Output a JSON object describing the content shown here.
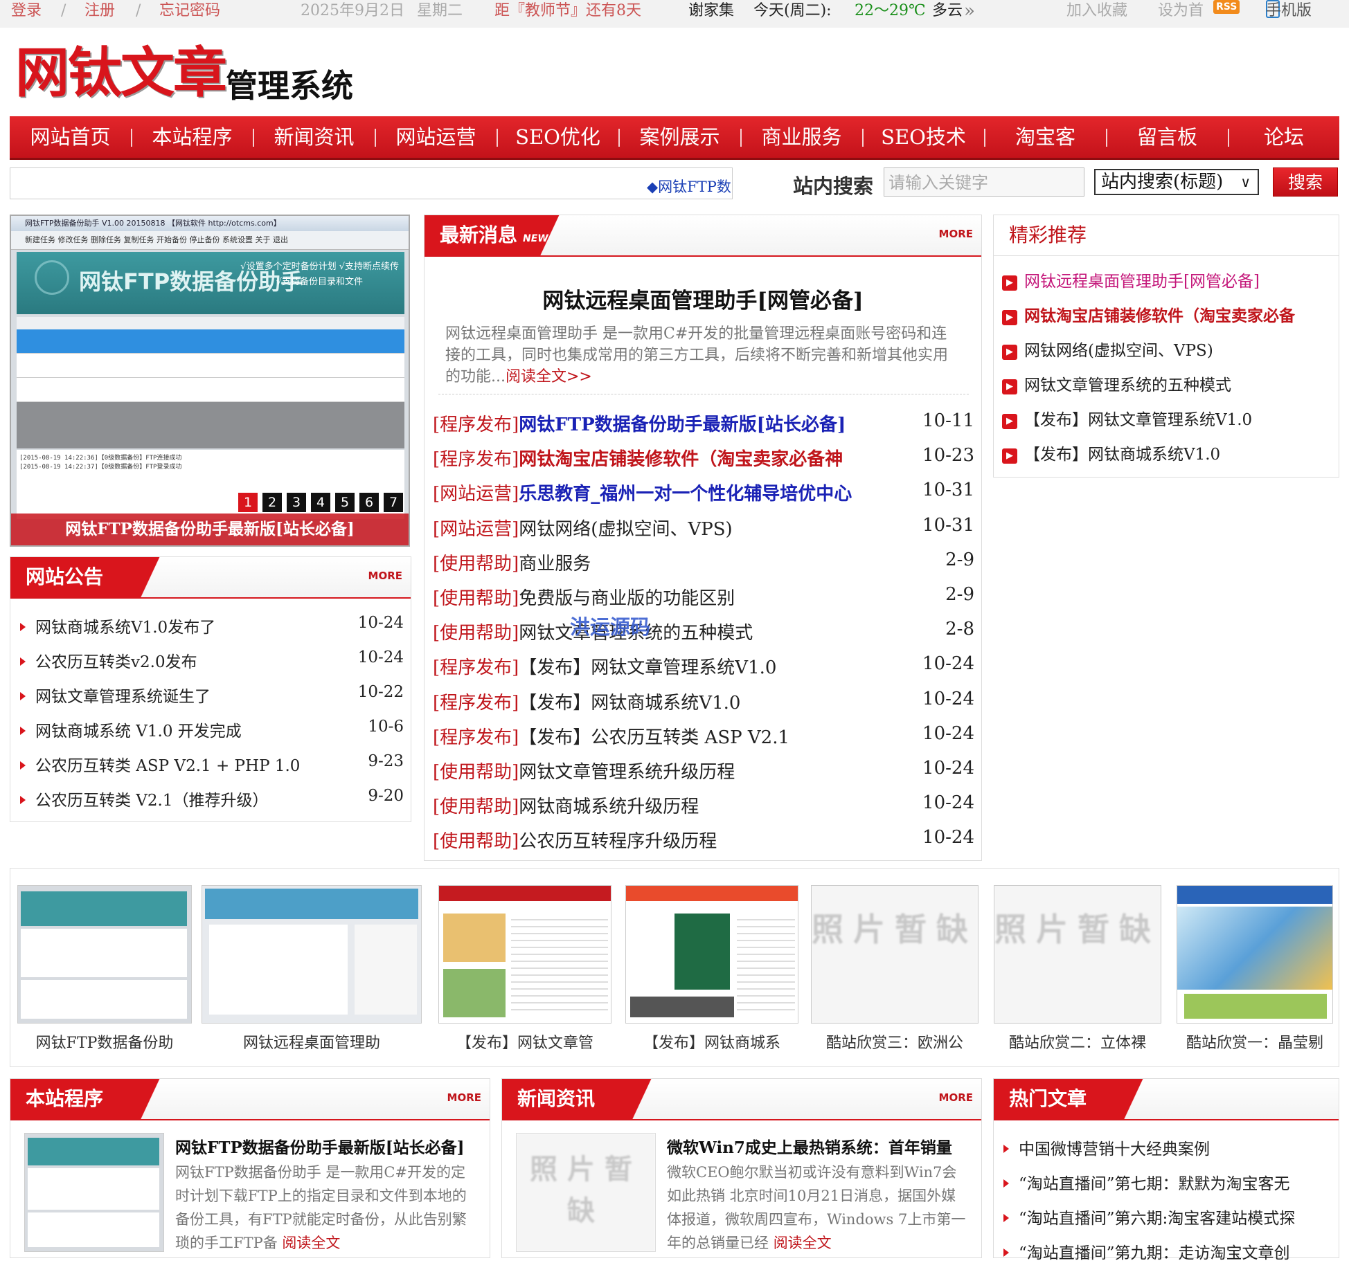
{
  "topbar": {
    "login": "登录",
    "sep1": "/",
    "register": "注册",
    "sep2": "/",
    "forgot": "忘记密码",
    "date": "2025年9月2日",
    "weekday": "星期二",
    "countdown_prefix": "距『教师节』还有8天",
    "city": "谢家集",
    "weather_prefix": "今天(周二):",
    "temp": "22～29℃",
    "weather_desc": "多云",
    "weather_more": "»",
    "favorite": "加入收藏",
    "homepage": "设为首",
    "rss": "RSS",
    "mobile": "手机版"
  },
  "logo": {
    "main": "网钛文章",
    "sub": "管理系统"
  },
  "nav": [
    "网站首页",
    "本站程序",
    "新闻资讯",
    "网站运营",
    "SEO优化",
    "案例展示",
    "商业服务",
    "SEO技术",
    "淘宝客",
    "留言板",
    "论坛"
  ],
  "search": {
    "marquee": "◆网钛FTP数据备份助手",
    "label": "站内搜索",
    "placeholder": "请输入关键字",
    "select": "站内搜索(标题)",
    "button": "搜索"
  },
  "slide": {
    "window_title": "网钛FTP数据备份助手 V1.00 20150818 【网钛软件 http://otcms.com】",
    "toolbar": "新建任务  修改任务  删除任务  复制任务  开始备份  停止备份  系统设置  关于  退出",
    "banner_title": "网钛FTP数据备份助手",
    "banner_line1": "√设置多个定时备份计划  √支持断点续传",
    "banner_line2": "√支持备份目录和文件",
    "log_line1": "[2015-08-19 14:22:36]【0级数据备份】FTP连接成功",
    "log_line2": "[2015-08-19 14:22:37]【0级数据备份】FTP登录成功",
    "caption": "网钛FTP数据备份助手最新版[站长必备]",
    "pages": [
      "1",
      "2",
      "3",
      "4",
      "5",
      "6",
      "7"
    ]
  },
  "notice": {
    "title": "网站公告",
    "more": "MORE",
    "items": [
      {
        "text": "网钛商城系统V1.0发布了",
        "date": "10-24"
      },
      {
        "text": "公农历互转类v2.0发布",
        "date": "10-24"
      },
      {
        "text": "网钛文章管理系统诞生了",
        "date": "10-22"
      },
      {
        "text": "网钛商城系统 V1.0 开发完成",
        "date": "10-6"
      },
      {
        "text": "公农历互转类 ASP V2.1 + PHP 1.0",
        "date": "9-23"
      },
      {
        "text": "公农历互转类 V2.1（推荐升级）",
        "date": "9-20"
      }
    ]
  },
  "news": {
    "title": "最新消息",
    "tag": "NEW",
    "more": "MORE",
    "headline": "网钛远程桌面管理助手[网管必备]",
    "summary": "网钛远程桌面管理助手 是一款用C#开发的批量管理远程桌面账号密码和连接的工具，同时也集成常用的第三方工具，后续将不断完善和新增其他实用的功能...",
    "readmore": "阅读全文>>",
    "items": [
      {
        "cat": "[程序发布]",
        "text": "网钛FTP数据备份助手最新版[站长必备]",
        "date": "10-11",
        "style": "blue"
      },
      {
        "cat": "[程序发布]",
        "text": "网钛淘宝店铺装修软件（淘宝卖家必备神",
        "date": "10-23",
        "style": "red"
      },
      {
        "cat": "[网站运营]",
        "text": "乐思教育_福州一对一个性化辅导培优中心",
        "date": "10-31",
        "style": "blue"
      },
      {
        "cat": "[网站运营]",
        "text": "网钛网络(虚拟空间、VPS)",
        "date": "10-31",
        "style": "plain"
      },
      {
        "cat": "[使用帮助]",
        "text": "商业服务",
        "date": "2-9",
        "style": "plain"
      },
      {
        "cat": "[使用帮助]",
        "text": "免费版与商业版的功能区别",
        "date": "2-9",
        "style": "plain"
      },
      {
        "cat": "[使用帮助]",
        "text": "网钛文章管理系统的五种模式",
        "date": "2-8",
        "style": "plain"
      },
      {
        "cat": "[程序发布]",
        "text": "【发布】网钛文章管理系统V1.0",
        "date": "10-24",
        "style": "plain"
      },
      {
        "cat": "[程序发布]",
        "text": "【发布】网钛商城系统V1.0",
        "date": "10-24",
        "style": "plain"
      },
      {
        "cat": "[程序发布]",
        "text": "【发布】公农历互转类 ASP V2.1",
        "date": "10-24",
        "style": "plain"
      },
      {
        "cat": "[使用帮助]",
        "text": "网钛文章管理系统升级历程",
        "date": "10-24",
        "style": "plain"
      },
      {
        "cat": "[使用帮助]",
        "text": "网钛商城系统升级历程",
        "date": "10-24",
        "style": "plain"
      },
      {
        "cat": "[使用帮助]",
        "text": "公农历互转程序升级历程",
        "date": "10-24",
        "style": "plain"
      }
    ],
    "watermark": "洪运源码"
  },
  "recommend": {
    "title": "精彩推荐",
    "items": [
      {
        "text": "网钛远程桌面管理助手[网管必备]",
        "style": "magenta"
      },
      {
        "text": "网钛淘宝店铺装修软件（淘宝卖家必备",
        "style": "red"
      },
      {
        "text": "网钛网络(虚拟空间、VPS)",
        "style": "plain"
      },
      {
        "text": "网钛文章管理系统的五种模式",
        "style": "plain"
      },
      {
        "text": "【发布】网钛文章管理系统V1.0",
        "style": "plain"
      },
      {
        "text": "【发布】网钛商城系统V1.0",
        "style": "plain"
      }
    ]
  },
  "gallery": {
    "nopic_text": "照片暂缺",
    "captions": [
      "网钛FTP数据备份助",
      "网钛远程桌面管理助",
      "【发布】网钛文章管",
      "【发布】网钛商城系",
      "酷站欣赏三：欧洲公",
      "酷站欣赏二：立体裸",
      "酷站欣赏一：晶莹剔"
    ]
  },
  "program": {
    "title": "本站程序",
    "more": "MORE",
    "art_title": "网钛FTP数据备份助手最新版[站长必备]",
    "art_body": "网钛FTP数据备份助手 是一款用C#开发的定时计划下载FTP上的指定目录和文件到本地的备份工具，有FTP就能定时备份，从此告别繁琐的手工FTP备",
    "readmore": "阅读全文"
  },
  "newsinfo": {
    "title": "新闻资讯",
    "more": "MORE",
    "art_title": "微软Win7成史上最热销系统：首年销量",
    "art_body": "微软CEO鲍尔默当初或许没有意料到Win7会如此热销 北京时间10月21日消息，据国外媒体报道，微软周四宣布，Windows 7上市第一年的总销量已经",
    "readmore": "阅读全文"
  },
  "hot": {
    "title": "热门文章",
    "items": [
      "中国微博营销十大经典案例",
      "“淘站直播间”第七期：默默为淘宝客无",
      "“淘站直播间”第六期:淘宝客建站模式探",
      "“淘站直播间”第九期：走访淘宝文章创"
    ]
  },
  "colors": {
    "brand_red": "#d9151c",
    "link_blue": "#1a22b5",
    "temp_green": "#1a8f1a"
  }
}
